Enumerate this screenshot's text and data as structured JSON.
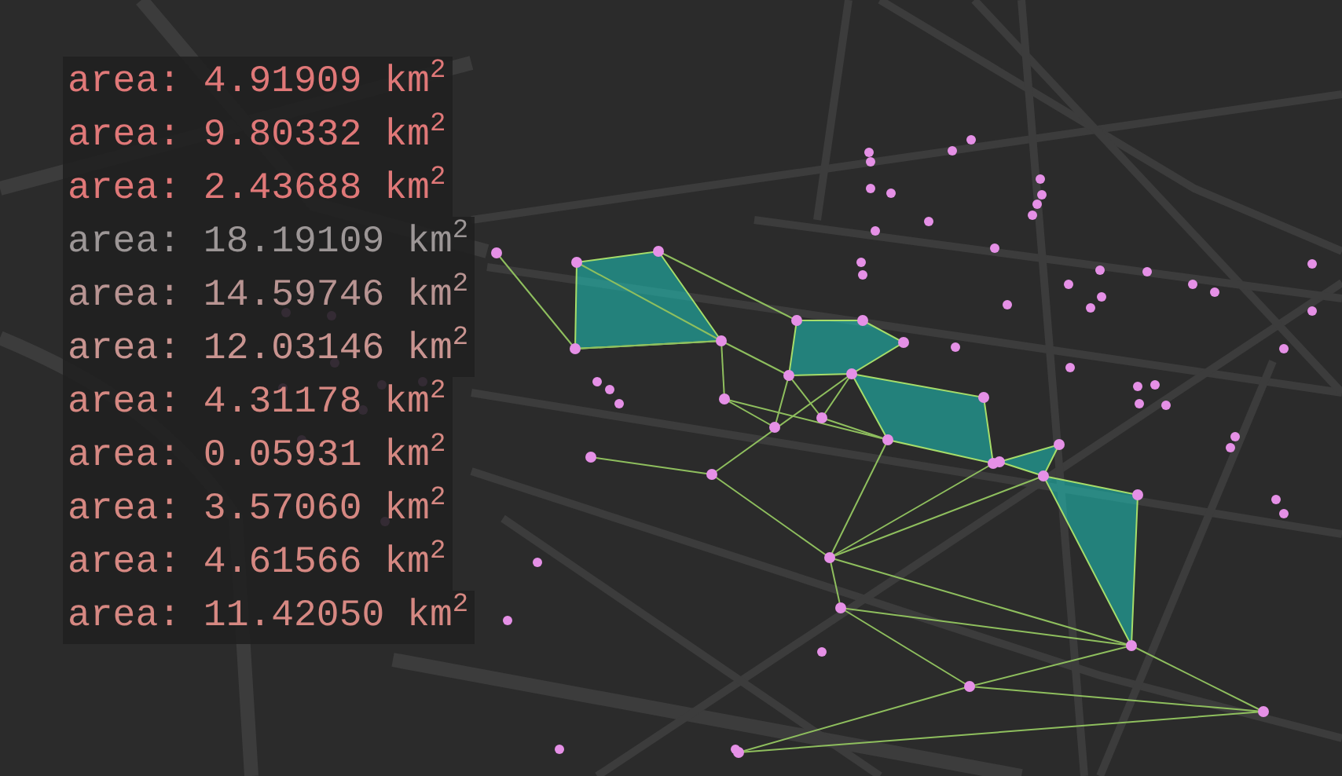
{
  "area_panel": {
    "rows": [
      {
        "text": "area: 4.91909 km$^{2}$",
        "color": "#e07878"
      },
      {
        "text": "area: 9.80332 km$^{2}$",
        "color": "#e07878"
      },
      {
        "text": "area: 2.43688 km$^{2}$",
        "color": "#e07878"
      },
      {
        "text": "area: 18.19109 km$^{2}$",
        "color": "#9c9696"
      },
      {
        "text": "area: 14.59746 km$^{2}$",
        "color": "#b89492"
      },
      {
        "text": "area: 12.03146 km$^{2}$",
        "color": "#c99490"
      },
      {
        "text": "area: 4.31178 km$^{2}$",
        "color": "#d68882"
      },
      {
        "text": "area: 0.05931 km$^{2}$",
        "color": "#d68882"
      },
      {
        "text": "area: 3.57060 km$^{2}$",
        "color": "#d68882"
      },
      {
        "text": "area: 4.61566 km$^{2}$",
        "color": "#d68882"
      },
      {
        "text": "area: 11.42050 km$^{2}$",
        "color": "#d68882"
      }
    ]
  }
}
